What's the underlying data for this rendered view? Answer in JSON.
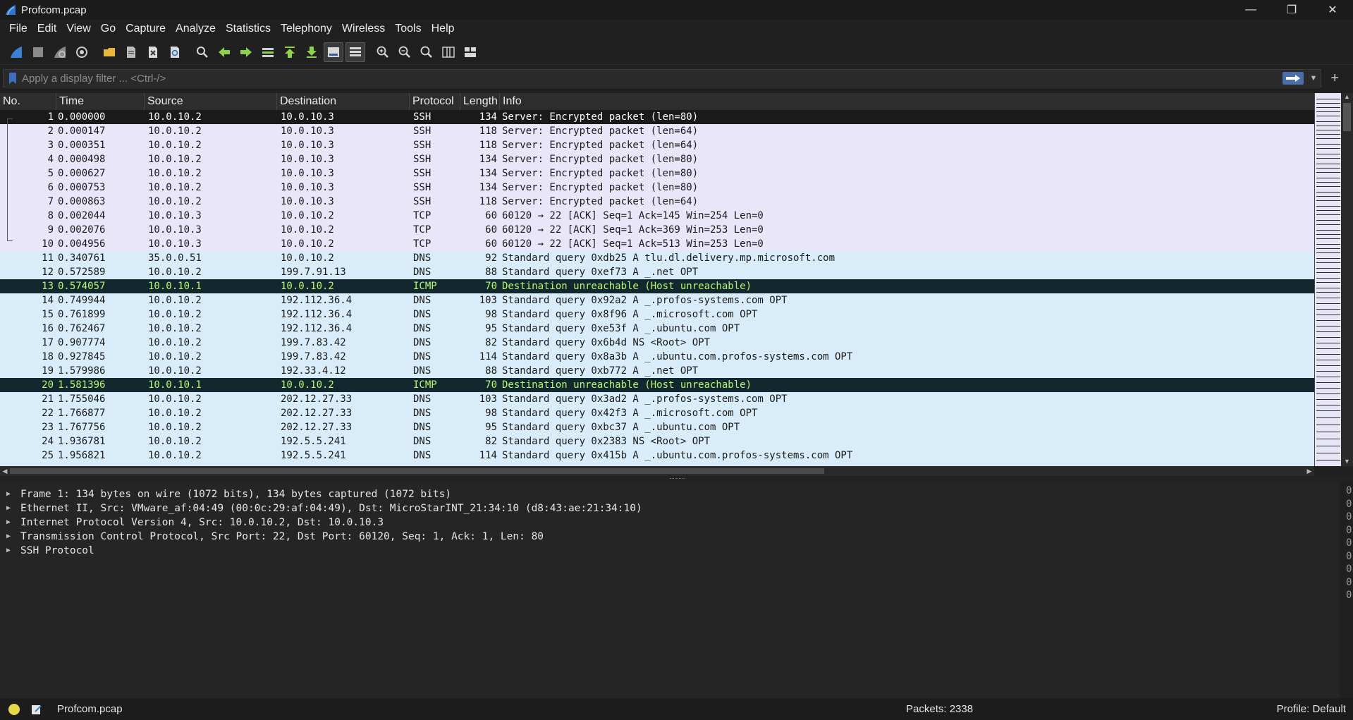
{
  "window": {
    "title": "Profcom.pcap",
    "controls": {
      "minimize": "—",
      "maximize": "❐",
      "close": "✕"
    }
  },
  "menu": [
    "File",
    "Edit",
    "View",
    "Go",
    "Capture",
    "Analyze",
    "Statistics",
    "Telephony",
    "Wireless",
    "Tools",
    "Help"
  ],
  "toolbar": {
    "icons": [
      "start-capture-icon",
      "stop-capture-icon",
      "restart-capture-icon",
      "capture-options-icon",
      "open-file-icon",
      "save-file-icon",
      "close-file-icon",
      "reload-file-icon",
      "find-packet-icon",
      "go-back-icon",
      "go-forward-icon",
      "go-to-packet-icon",
      "go-first-icon",
      "go-last-icon",
      "autoscroll-icon",
      "colorize-icon",
      "zoom-in-icon",
      "zoom-out-icon",
      "zoom-normal-icon",
      "resize-columns-icon",
      "layout-icon"
    ]
  },
  "filter": {
    "placeholder": "Apply a display filter ... <Ctrl-/>",
    "value": ""
  },
  "packet_list": {
    "columns": [
      "No.",
      "Time",
      "Source",
      "Destination",
      "Protocol",
      "Length",
      "Info"
    ],
    "rows": [
      {
        "no": "1",
        "time": "0.000000",
        "src": "10.0.10.2",
        "dst": "10.0.10.3",
        "proto": "SSH",
        "len": "134",
        "info": "Server: Encrypted packet (len=80)",
        "kind": "selected"
      },
      {
        "no": "2",
        "time": "0.000147",
        "src": "10.0.10.2",
        "dst": "10.0.10.3",
        "proto": "SSH",
        "len": "118",
        "info": "Server: Encrypted packet (len=64)",
        "kind": "ssh"
      },
      {
        "no": "3",
        "time": "0.000351",
        "src": "10.0.10.2",
        "dst": "10.0.10.3",
        "proto": "SSH",
        "len": "118",
        "info": "Server: Encrypted packet (len=64)",
        "kind": "ssh"
      },
      {
        "no": "4",
        "time": "0.000498",
        "src": "10.0.10.2",
        "dst": "10.0.10.3",
        "proto": "SSH",
        "len": "134",
        "info": "Server: Encrypted packet (len=80)",
        "kind": "ssh"
      },
      {
        "no": "5",
        "time": "0.000627",
        "src": "10.0.10.2",
        "dst": "10.0.10.3",
        "proto": "SSH",
        "len": "134",
        "info": "Server: Encrypted packet (len=80)",
        "kind": "ssh"
      },
      {
        "no": "6",
        "time": "0.000753",
        "src": "10.0.10.2",
        "dst": "10.0.10.3",
        "proto": "SSH",
        "len": "134",
        "info": "Server: Encrypted packet (len=80)",
        "kind": "ssh"
      },
      {
        "no": "7",
        "time": "0.000863",
        "src": "10.0.10.2",
        "dst": "10.0.10.3",
        "proto": "SSH",
        "len": "118",
        "info": "Server: Encrypted packet (len=64)",
        "kind": "ssh"
      },
      {
        "no": "8",
        "time": "0.002044",
        "src": "10.0.10.3",
        "dst": "10.0.10.2",
        "proto": "TCP",
        "len": "60",
        "info": "60120 → 22 [ACK] Seq=1 Ack=145 Win=254 Len=0",
        "kind": "tcp"
      },
      {
        "no": "9",
        "time": "0.002076",
        "src": "10.0.10.3",
        "dst": "10.0.10.2",
        "proto": "TCP",
        "len": "60",
        "info": "60120 → 22 [ACK] Seq=1 Ack=369 Win=253 Len=0",
        "kind": "tcp"
      },
      {
        "no": "10",
        "time": "0.004956",
        "src": "10.0.10.3",
        "dst": "10.0.10.2",
        "proto": "TCP",
        "len": "60",
        "info": "60120 → 22 [ACK] Seq=1 Ack=513 Win=253 Len=0",
        "kind": "tcp"
      },
      {
        "no": "11",
        "time": "0.340761",
        "src": "35.0.0.51",
        "dst": "10.0.10.2",
        "proto": "DNS",
        "len": "92",
        "info": "Standard query 0xdb25 A tlu.dl.delivery.mp.microsoft.com",
        "kind": "dns"
      },
      {
        "no": "12",
        "time": "0.572589",
        "src": "10.0.10.2",
        "dst": "199.7.91.13",
        "proto": "DNS",
        "len": "88",
        "info": "Standard query 0xef73 A _.net OPT",
        "kind": "dns"
      },
      {
        "no": "13",
        "time": "0.574057",
        "src": "10.0.10.1",
        "dst": "10.0.10.2",
        "proto": "ICMP",
        "len": "70",
        "info": "Destination unreachable (Host unreachable)",
        "kind": "icmp"
      },
      {
        "no": "14",
        "time": "0.749944",
        "src": "10.0.10.2",
        "dst": "192.112.36.4",
        "proto": "DNS",
        "len": "103",
        "info": "Standard query 0x92a2 A _.profos-systems.com OPT",
        "kind": "dns"
      },
      {
        "no": "15",
        "time": "0.761899",
        "src": "10.0.10.2",
        "dst": "192.112.36.4",
        "proto": "DNS",
        "len": "98",
        "info": "Standard query 0x8f96 A _.microsoft.com OPT",
        "kind": "dns"
      },
      {
        "no": "16",
        "time": "0.762467",
        "src": "10.0.10.2",
        "dst": "192.112.36.4",
        "proto": "DNS",
        "len": "95",
        "info": "Standard query 0xe53f A _.ubuntu.com OPT",
        "kind": "dns"
      },
      {
        "no": "17",
        "time": "0.907774",
        "src": "10.0.10.2",
        "dst": "199.7.83.42",
        "proto": "DNS",
        "len": "82",
        "info": "Standard query 0x6b4d NS <Root> OPT",
        "kind": "dns"
      },
      {
        "no": "18",
        "time": "0.927845",
        "src": "10.0.10.2",
        "dst": "199.7.83.42",
        "proto": "DNS",
        "len": "114",
        "info": "Standard query 0x8a3b A _.ubuntu.com.profos-systems.com OPT",
        "kind": "dns"
      },
      {
        "no": "19",
        "time": "1.579986",
        "src": "10.0.10.2",
        "dst": "192.33.4.12",
        "proto": "DNS",
        "len": "88",
        "info": "Standard query 0xb772 A _.net OPT",
        "kind": "dns"
      },
      {
        "no": "20",
        "time": "1.581396",
        "src": "10.0.10.1",
        "dst": "10.0.10.2",
        "proto": "ICMP",
        "len": "70",
        "info": "Destination unreachable (Host unreachable)",
        "kind": "icmp"
      },
      {
        "no": "21",
        "time": "1.755046",
        "src": "10.0.10.2",
        "dst": "202.12.27.33",
        "proto": "DNS",
        "len": "103",
        "info": "Standard query 0x3ad2 A _.profos-systems.com OPT",
        "kind": "dns"
      },
      {
        "no": "22",
        "time": "1.766877",
        "src": "10.0.10.2",
        "dst": "202.12.27.33",
        "proto": "DNS",
        "len": "98",
        "info": "Standard query 0x42f3 A _.microsoft.com OPT",
        "kind": "dns"
      },
      {
        "no": "23",
        "time": "1.767756",
        "src": "10.0.10.2",
        "dst": "202.12.27.33",
        "proto": "DNS",
        "len": "95",
        "info": "Standard query 0xbc37 A _.ubuntu.com OPT",
        "kind": "dns"
      },
      {
        "no": "24",
        "time": "1.936781",
        "src": "10.0.10.2",
        "dst": "192.5.5.241",
        "proto": "DNS",
        "len": "82",
        "info": "Standard query 0x2383 NS <Root> OPT",
        "kind": "dns"
      },
      {
        "no": "25",
        "time": "1.956821",
        "src": "10.0.10.2",
        "dst": "192.5.5.241",
        "proto": "DNS",
        "len": "114",
        "info": "Standard query 0x415b A _.ubuntu.com.profos-systems.com OPT",
        "kind": "dns"
      }
    ]
  },
  "details": [
    "Frame 1: 134 bytes on wire (1072 bits), 134 bytes captured (1072 bits)",
    "Ethernet II, Src: VMware_af:04:49 (00:0c:29:af:04:49), Dst: MicroStarINT_21:34:10 (d8:43:ae:21:34:10)",
    "Internet Protocol Version 4, Src: 10.0.10.2, Dst: 10.0.10.3",
    "Transmission Control Protocol, Src Port: 22, Dst Port: 60120, Seq: 1, Ack: 1, Len: 80",
    "SSH Protocol"
  ],
  "bytes_pane": [
    "0",
    "0",
    "0",
    "0",
    "0",
    "0",
    "0",
    "0",
    "0"
  ],
  "status": {
    "file": "Profcom.pcap",
    "packets": "Packets: 2338",
    "profile": "Profile: Default"
  }
}
